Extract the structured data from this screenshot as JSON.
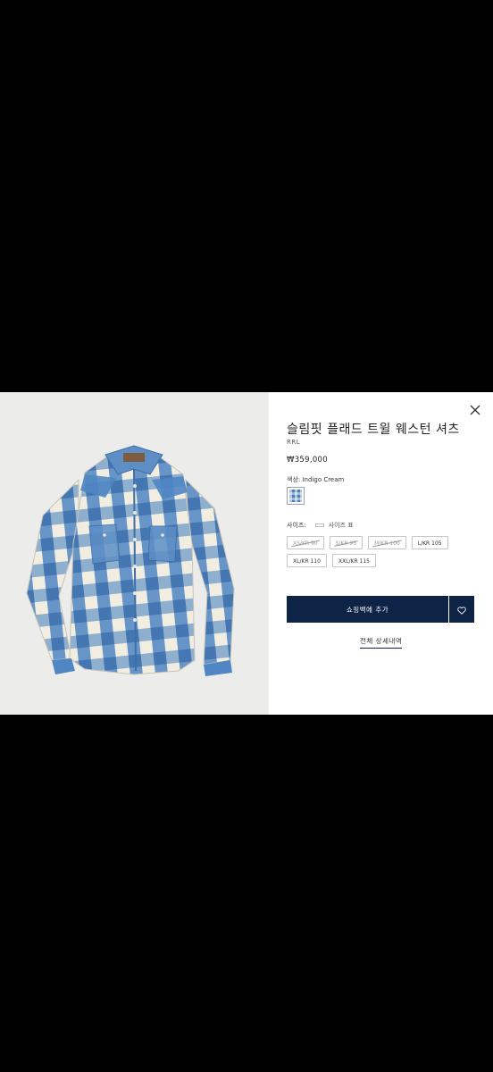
{
  "product": {
    "title": "슬림핏 플래드 트윌 웨스턴 셔츠",
    "brand": "RRL",
    "price": "₩359,000",
    "color_label": "색상:",
    "color_value": "Indigo Cream",
    "size_label": "사이즈:",
    "size_guide": "사이즈 표",
    "sizes": [
      {
        "label": "XS/KR 90",
        "available": false
      },
      {
        "label": "S/KR 95",
        "available": false
      },
      {
        "label": "M/KR 100",
        "available": false
      },
      {
        "label": "L/KR 105",
        "available": true
      },
      {
        "label": "XL/KR 110",
        "available": true
      },
      {
        "label": "XXL/KR 115",
        "available": true
      }
    ],
    "add_to_bag": "쇼핑백에 추가",
    "full_details": "전체 상세내역"
  },
  "icons": {
    "close": "close-icon",
    "heart": "heart-icon",
    "ruler": "ruler-icon"
  },
  "colors": {
    "accent": "#0e2447",
    "overlay": "#000000",
    "image_bg": "#ececea"
  }
}
